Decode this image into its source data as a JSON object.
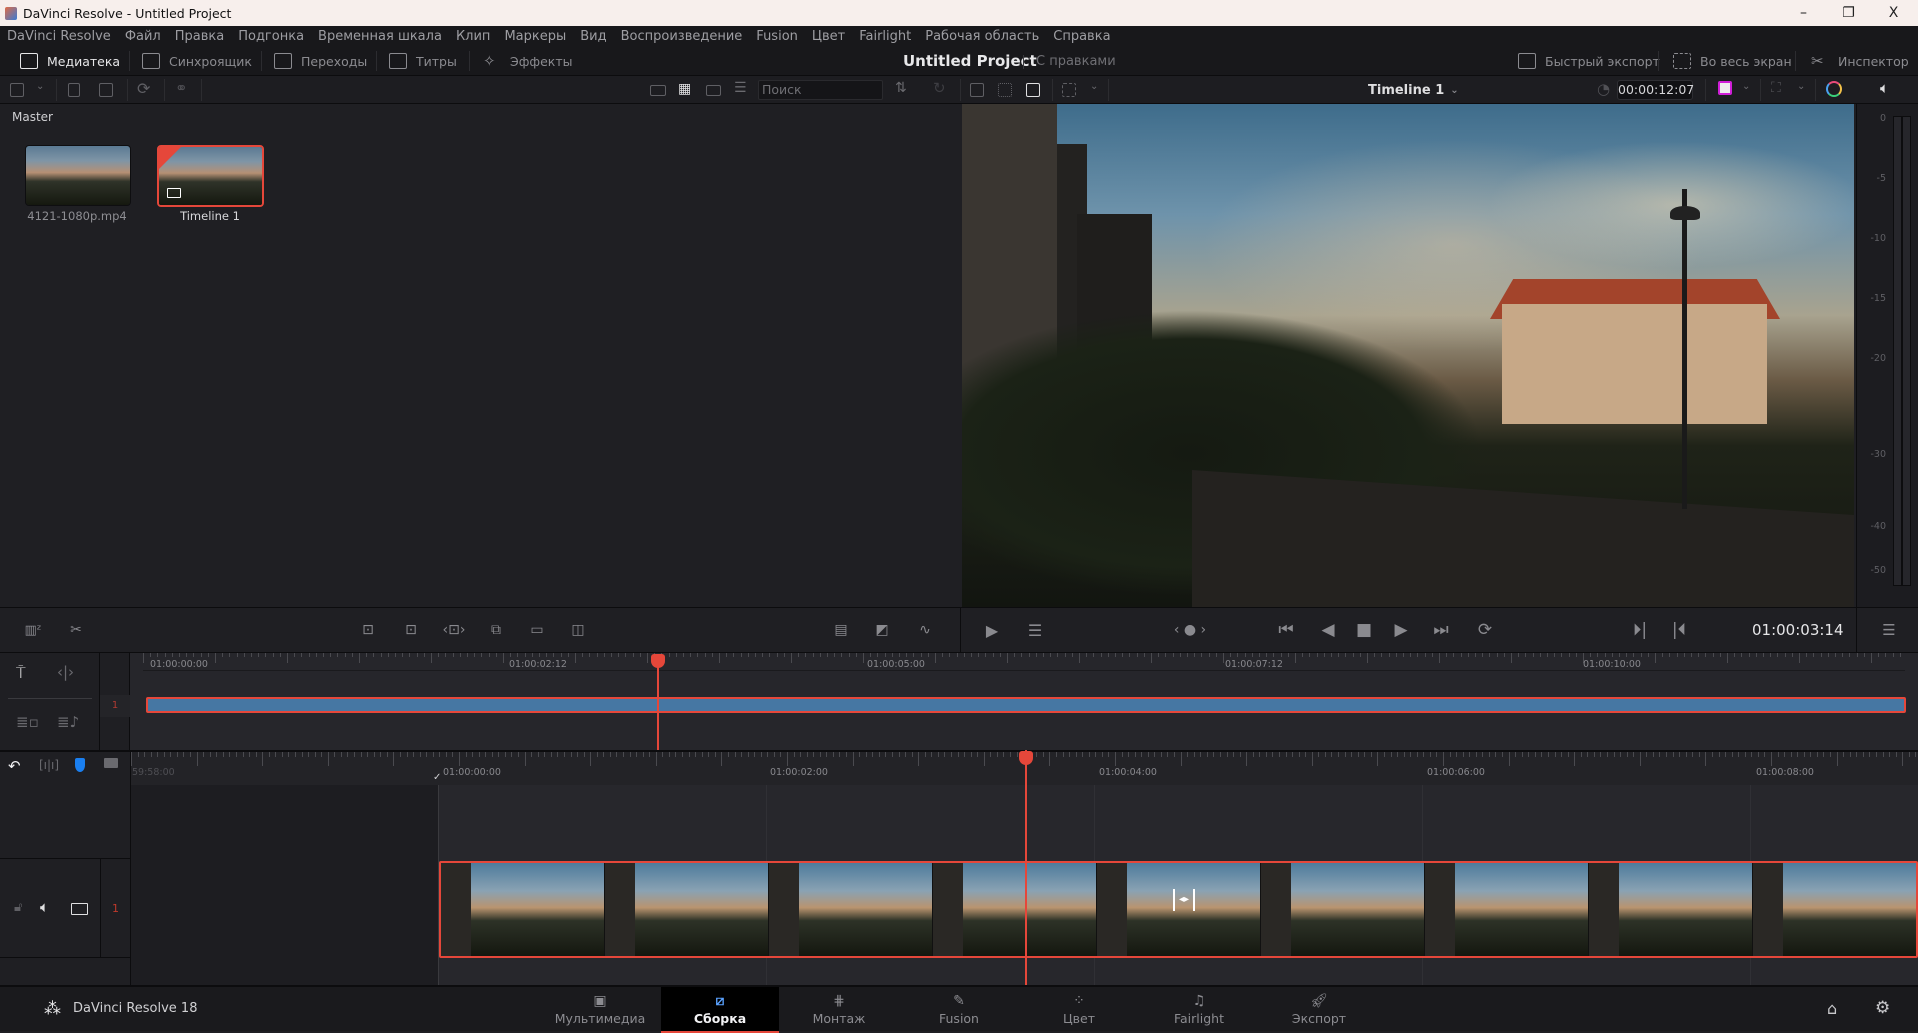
{
  "window": {
    "title": "DaVinci Resolve - Untitled Project",
    "controls": {
      "minimize": "–",
      "maximize": "❐",
      "close": "X"
    }
  },
  "menu": [
    "DaVinci Resolve",
    "Файл",
    "Правка",
    "Подгонка",
    "Временная шкала",
    "Клип",
    "Маркеры",
    "Вид",
    "Воспроизведение",
    "Fusion",
    "Цвет",
    "Fairlight",
    "Рабочая область",
    "Справка"
  ],
  "toolbar": {
    "left": [
      {
        "label": "Медиатека",
        "icon": "media-pool-icon",
        "active": true
      },
      {
        "label": "Синхроящик",
        "icon": "sync-bin-icon",
        "active": false
      },
      {
        "label": "Переходы",
        "icon": "transitions-icon",
        "active": false
      },
      {
        "label": "Титры",
        "icon": "titles-icon",
        "active": false
      },
      {
        "label": "Эффекты",
        "icon": "effects-icon",
        "active": false
      }
    ],
    "project_title": "Untitled Project",
    "project_status": "С правками",
    "right": [
      {
        "label": "Быстрый экспорт",
        "icon": "quick-export-icon"
      },
      {
        "label": "Во весь экран",
        "icon": "fullscreen-icon"
      },
      {
        "label": "Инспектор",
        "icon": "inspector-icon"
      }
    ]
  },
  "media_pool": {
    "search_placeholder": "Поиск",
    "bin": "Master",
    "clips": [
      {
        "name": "4121-1080p.mp4",
        "selected": false,
        "type": "video"
      },
      {
        "name": "Timeline 1",
        "selected": true,
        "type": "timeline"
      }
    ]
  },
  "viewer": {
    "timeline_name": "Timeline 1",
    "duration_timecode": "00:00:12:07",
    "current_timecode": "01:00:03:14"
  },
  "audio_meter": {
    "scale": [
      "0",
      "-5",
      "-10",
      "-15",
      "-20",
      "-30",
      "-40",
      "-50"
    ]
  },
  "upper_timeline": {
    "track_number": "1",
    "ruler_labels": [
      "01:00:00:00",
      "01:00:02:12",
      "01:00:05:00",
      "01:00:07:12",
      "01:00:10:00"
    ],
    "playhead_fraction": 0.29
  },
  "lower_timeline": {
    "ruler_labels": [
      "59:58:00",
      "01:00:00:00",
      "01:00:02:00",
      "01:00:04:00",
      "01:00:06:00",
      "01:00:08:00"
    ],
    "track_number": "1"
  },
  "pages": [
    {
      "label": "Мультимедиа",
      "icon": "media-page-icon",
      "active": false
    },
    {
      "label": "Сборка",
      "icon": "cut-page-icon",
      "active": true
    },
    {
      "label": "Монтаж",
      "icon": "edit-page-icon",
      "active": false
    },
    {
      "label": "Fusion",
      "icon": "fusion-page-icon",
      "active": false
    },
    {
      "label": "Цвет",
      "icon": "color-page-icon",
      "active": false
    },
    {
      "label": "Fairlight",
      "icon": "fairlight-page-icon",
      "active": false
    },
    {
      "label": "Экспорт",
      "icon": "deliver-page-icon",
      "active": false
    }
  ],
  "app_name": "DaVinci Resolve 18",
  "colors": {
    "accent_red": "#e5473a",
    "clip_blue": "#4677a3",
    "active_page_icon": "#5aa2ff"
  }
}
